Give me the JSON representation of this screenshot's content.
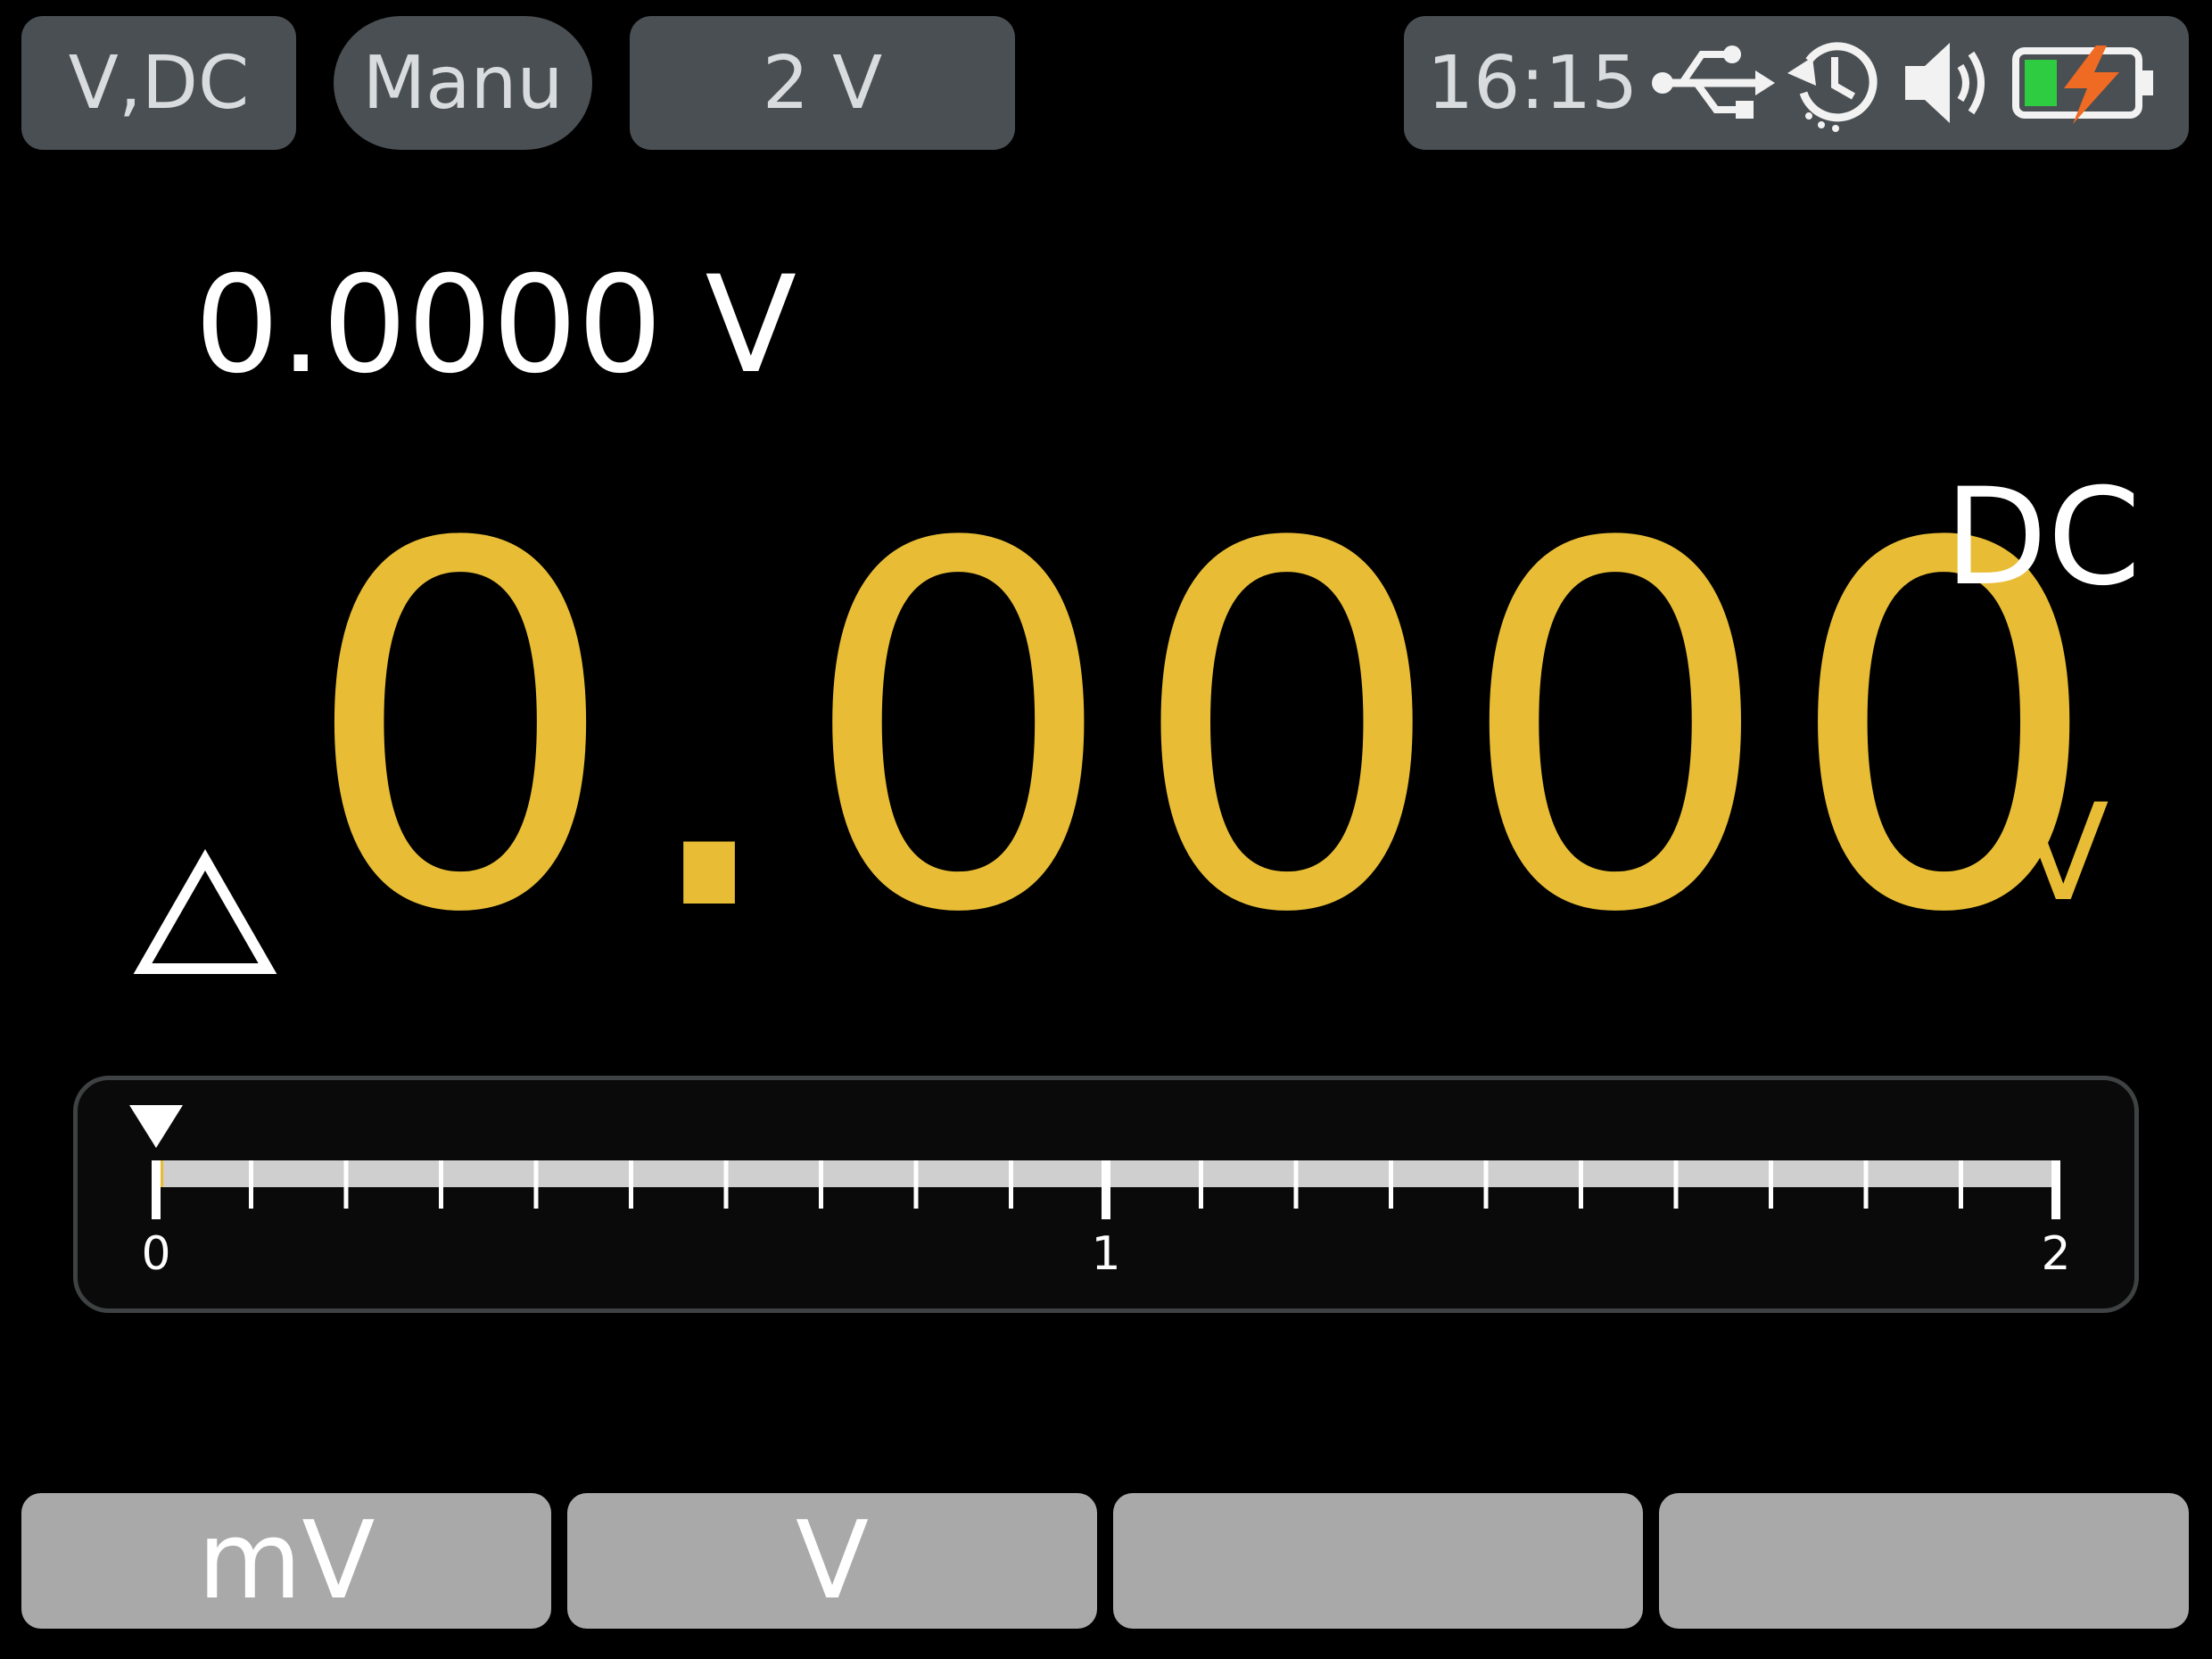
{
  "header": {
    "mode": "V,DC",
    "range_mode": "Manu",
    "range": "2 V"
  },
  "status": {
    "time": "16:15",
    "icons": [
      "usb-icon",
      "auto-power-off-timer-icon",
      "speaker-icon",
      "battery-charging-icon"
    ],
    "battery_level": 0.3,
    "battery_color": "#2ecc40",
    "charge_bolt_color": "#ef6a22"
  },
  "reading": {
    "secondary": "0.0000 V",
    "main": "0.0000",
    "coupling": "DC",
    "unit": "V",
    "relative_icon": "delta-icon",
    "main_color": "#e8bd35"
  },
  "bargraph": {
    "min": 0,
    "max": 2,
    "value": 0.0,
    "tick_labels": [
      "0",
      "1",
      "2"
    ],
    "minor_divisions": 20
  },
  "softkeys": [
    {
      "label": "mV"
    },
    {
      "label": "V"
    },
    {
      "label": ""
    },
    {
      "label": ""
    }
  ]
}
